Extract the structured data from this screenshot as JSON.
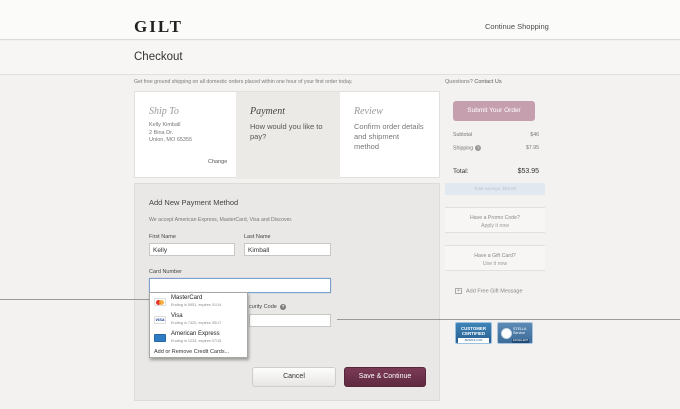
{
  "header": {
    "logo": "GILT",
    "continue_link": "Continue Shopping"
  },
  "page": {
    "title": "Checkout",
    "promo": "Get free ground shipping on all domestic orders placed within one hour of your first order today.",
    "questions_prefix": "Questions?",
    "questions_link": "Contact Us"
  },
  "steps": {
    "ship": {
      "title": "Ship To",
      "lines": [
        "Kelly Kimball",
        "2 Bina Dr.",
        "Union, MO 65355"
      ],
      "change_label": "Change"
    },
    "payment": {
      "title": "Payment",
      "subtitle": "How would you like to pay?"
    },
    "review": {
      "title": "Review",
      "subtitle": "Confirm order details and shipment method"
    }
  },
  "payment_form": {
    "title": "Add New Payment Method",
    "accepted": "We accept American Express, MasterCard, Visa and Discover.",
    "first_name_label": "First Name",
    "first_name_value": "Kelly",
    "last_name_label": "Last Name",
    "last_name_value": "Kimball",
    "card_number_label": "Card Number",
    "card_number_value": "",
    "security_code_label": "curity Code",
    "security_code_value": "",
    "cancel_label": "Cancel",
    "save_label": "Save & Continue"
  },
  "card_dropdown": {
    "items": [
      {
        "name": "MasterCard",
        "desc": "Ending in 5951, expires 01/14",
        "icon": "mastercard-icon"
      },
      {
        "name": "Visa",
        "desc": "Ending in 7420, expires 05/17",
        "icon": "visa-icon"
      },
      {
        "name": "American Express",
        "desc": "Ending in 1233, expires 07/15",
        "icon": "amex-icon"
      }
    ],
    "add_remove": "Add or Remove Credit Cards..."
  },
  "summary": {
    "submit_label": "Submit Your Order",
    "subtotal_label": "Subtotal",
    "subtotal_value": "$46",
    "shipping_label": "Shipping",
    "shipping_value": "$7.95",
    "total_label": "Total:",
    "total_value": "$53.95",
    "total_note": "Total savings: $68.00",
    "promo_title": "Have a Promo Code?",
    "promo_action": "Apply it now",
    "giftcard_title": "Have a Gift Card?",
    "giftcard_action": "Use it now",
    "gift_message": "Add Free Gift Message"
  },
  "badges": {
    "customer_line1": "CUSTOMER",
    "customer_line2": "CERTIFIED",
    "customer_sub": "BIZRATE.COM",
    "stella_line1": "STELLA",
    "stella_line2": "Service",
    "stella_sub": "EXCELLENT"
  },
  "colors": {
    "accent": "#6b2f49",
    "submit_disabled": "#c69fae",
    "focus_border": "#7d9fc9"
  }
}
